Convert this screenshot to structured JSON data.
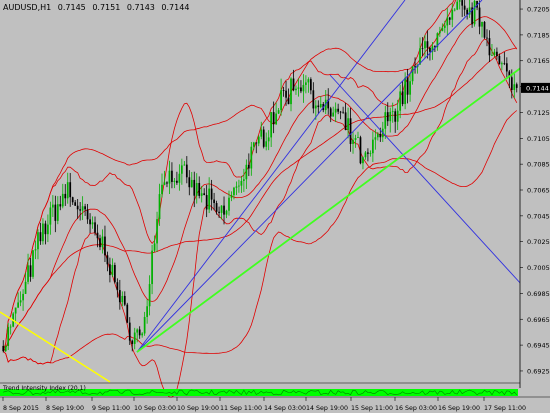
{
  "header": {
    "symbol": "AUDUSD,H1",
    "open": "0.7145",
    "high": "0.7151",
    "low": "0.7143",
    "close": "0.7144"
  },
  "indicator_label": "Trend Intensity Index (20,1)",
  "price_scale": [
    "0.7205",
    "0.7185",
    "0.7165",
    "0.7145",
    "0.7125",
    "0.7105",
    "0.7085",
    "0.7065",
    "0.7045",
    "0.7025",
    "0.7005",
    "0.6985",
    "0.6965",
    "0.6945",
    "0.6925"
  ],
  "current_price_tag": "0.7144",
  "time_labels": [
    "8 Sep 2015",
    "8 Sep 19:00",
    "9 Sep 11:00",
    "10 Sep 03:00",
    "10 Sep 19:00",
    "11 Sep 11:00",
    "14 Sep 03:00",
    "14 Sep 19:00",
    "15 Sep 11:00",
    "16 Sep 03:00",
    "16 Sep 19:00",
    "17 Sep 11:00"
  ],
  "colors": {
    "background": "#c0c0c0",
    "bull_candle": "#00b000",
    "bear_candle": "#000000",
    "bollinger": "#e00000",
    "blue_trendline": "#3030e0",
    "green_trendline": "#40ff20",
    "yellow_trendline": "#ffff00",
    "price_tag_bg": "#000000",
    "indicator": "#00ff00"
  },
  "chart_data": {
    "type": "candlestick",
    "symbol": "AUDUSD",
    "timeframe": "H1",
    "ylim": [
      0.6918,
      0.7212
    ],
    "grid": false,
    "price_keypoints": [
      [
        0,
        0.6945
      ],
      [
        8,
        0.6985
      ],
      [
        16,
        0.7035
      ],
      [
        26,
        0.7065
      ],
      [
        34,
        0.704
      ],
      [
        42,
        0.7015
      ],
      [
        50,
        0.696
      ],
      [
        56,
        0.695
      ],
      [
        64,
        0.7075
      ],
      [
        72,
        0.7075
      ],
      [
        80,
        0.706
      ],
      [
        88,
        0.7045
      ],
      [
        96,
        0.7075
      ],
      [
        104,
        0.7105
      ],
      [
        112,
        0.7135
      ],
      [
        120,
        0.715
      ],
      [
        124,
        0.7145
      ],
      [
        128,
        0.7125
      ],
      [
        134,
        0.7125
      ],
      [
        142,
        0.71
      ],
      [
        146,
        0.7085
      ],
      [
        152,
        0.711
      ],
      [
        160,
        0.7135
      ],
      [
        170,
        0.7175
      ],
      [
        176,
        0.7185
      ],
      [
        184,
        0.7205
      ],
      [
        192,
        0.72
      ],
      [
        200,
        0.716
      ],
      [
        206,
        0.7145
      ]
    ]
  }
}
